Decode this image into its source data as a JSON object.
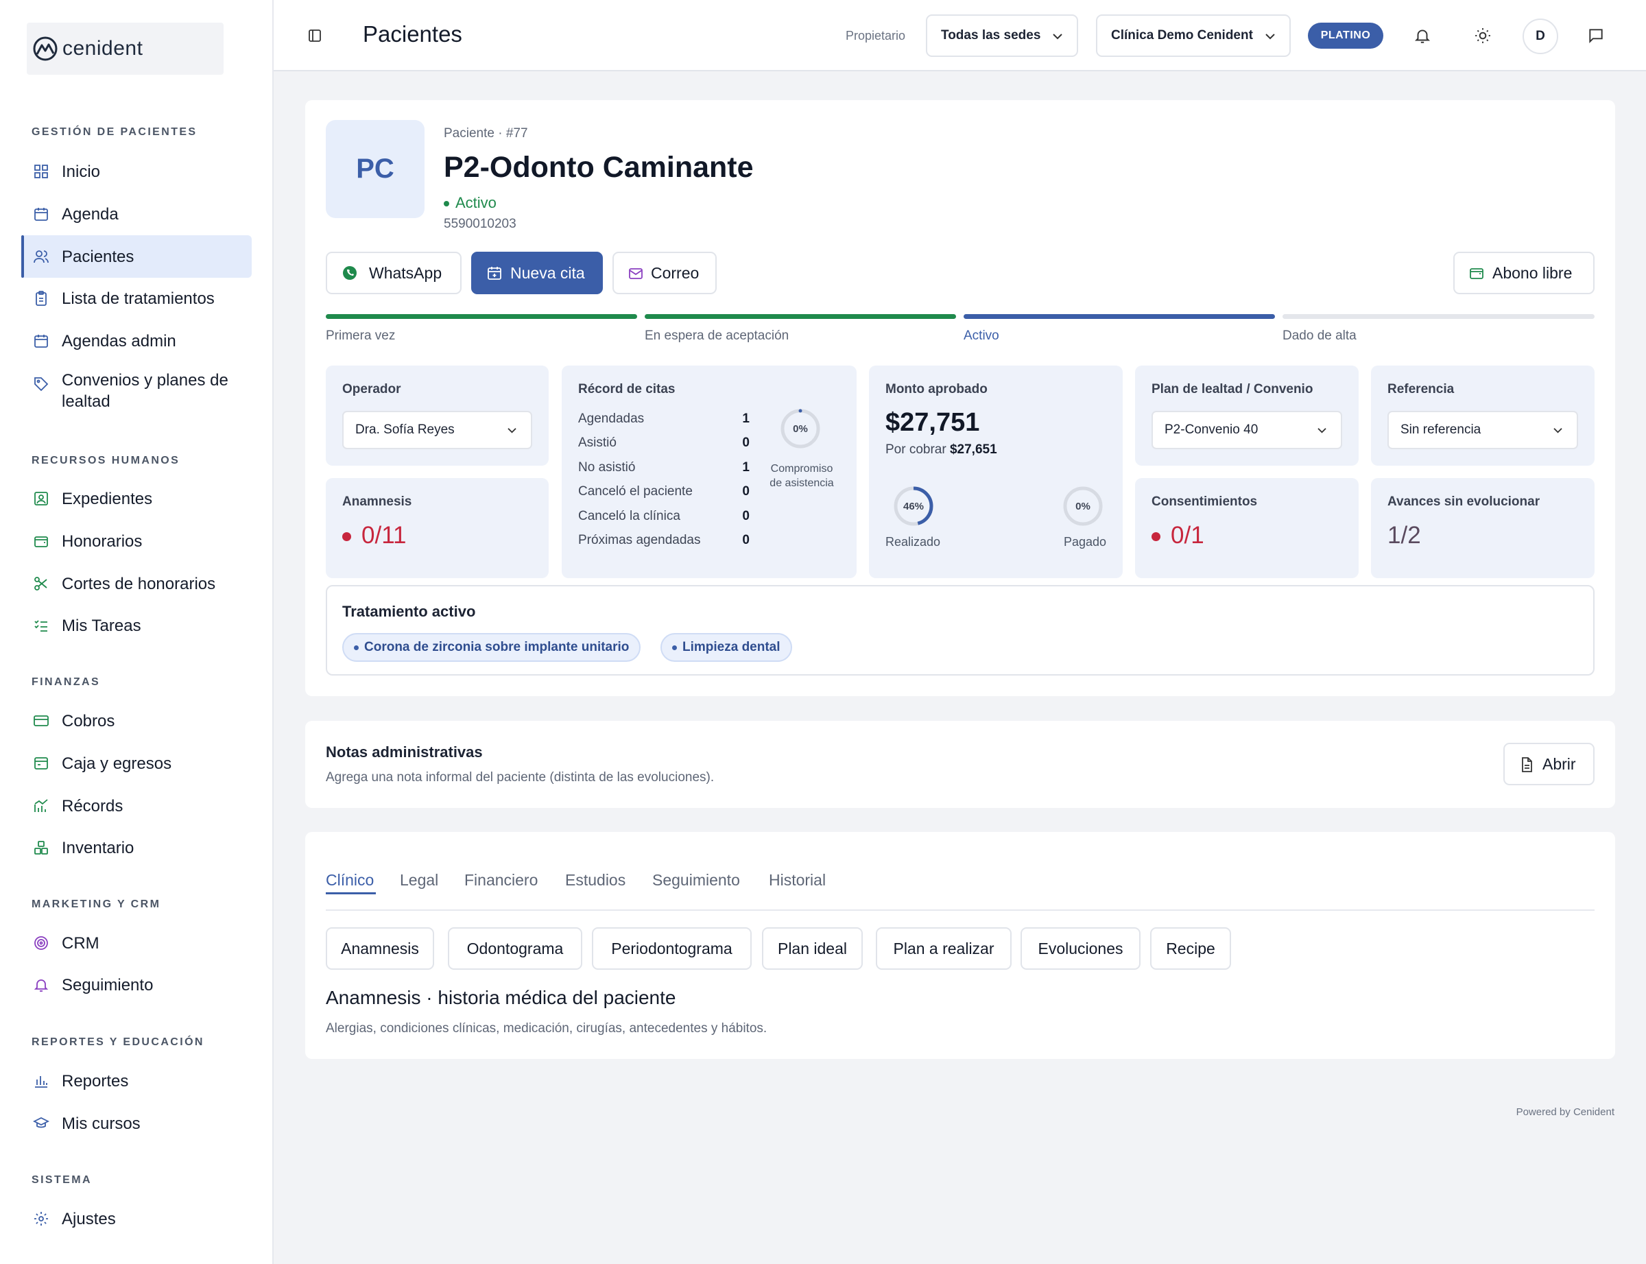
{
  "sidebar": {
    "logo_text": "cenident",
    "sections": [
      {
        "title": "GESTIÓN DE PACIENTES"
      },
      {
        "title": "RECURSOS HUMANOS"
      },
      {
        "title": "FINANZAS"
      },
      {
        "title": "MARKETING Y CRM"
      },
      {
        "title": "REPORTES Y EDUCACIÓN"
      },
      {
        "title": "SISTEMA"
      }
    ],
    "items": [
      {
        "label": "Inicio",
        "icon": "grid-icon"
      },
      {
        "label": "Agenda",
        "icon": "calendar-icon"
      },
      {
        "label": "Pacientes",
        "icon": "users-icon",
        "active": true
      },
      {
        "label": "Lista de tratamientos",
        "icon": "clipboard-icon"
      },
      {
        "label": "Agendas admin",
        "icon": "calendar-icon"
      },
      {
        "label": "Convenios y planes de lealtad",
        "icon": "tag-icon"
      },
      {
        "label": "Expedientes",
        "icon": "id-card-icon"
      },
      {
        "label": "Honorarios",
        "icon": "wallet-icon"
      },
      {
        "label": "Cortes de honorarios",
        "icon": "scissors-icon"
      },
      {
        "label": "Mis Tareas",
        "icon": "checklist-icon"
      },
      {
        "label": "Cobros",
        "icon": "credit-card-icon"
      },
      {
        "label": "Caja y egresos",
        "icon": "cash-register-icon"
      },
      {
        "label": "Récords",
        "icon": "chart-icon"
      },
      {
        "label": "Inventario",
        "icon": "boxes-icon"
      },
      {
        "label": "CRM",
        "icon": "target-icon"
      },
      {
        "label": "Seguimiento",
        "icon": "bell-icon"
      },
      {
        "label": "Reportes",
        "icon": "bar-chart-icon"
      },
      {
        "label": "Mis cursos",
        "icon": "graduation-icon"
      },
      {
        "label": "Ajustes",
        "icon": "gear-icon"
      }
    ]
  },
  "topbar": {
    "title": "Pacientes",
    "owner_label": "Propietario",
    "site_select": "Todas las sedes",
    "clinic_select": "Clínica Demo Cenident",
    "plan_badge": "PLATINO",
    "avatar_initial": "D"
  },
  "patient": {
    "initials": "PC",
    "meta": "Paciente · #77",
    "name": "P2-Odonto Caminante",
    "status": "Activo",
    "phone": "5590010203",
    "actions": {
      "whatsapp": "WhatsApp",
      "new_appointment": "Nueva cita",
      "email": "Correo",
      "free_payment": "Abono libre"
    },
    "stages": [
      {
        "label": "Primera vez",
        "state": "done",
        "color": "#1f8a4c"
      },
      {
        "label": "En espera de aceptación",
        "state": "done",
        "color": "#1f8a4c"
      },
      {
        "label": "Activo",
        "state": "current",
        "color": "#3b5ea8"
      },
      {
        "label": "Dado de alta",
        "state": "pending",
        "color": "#e4e6eb"
      }
    ],
    "operator": {
      "title": "Operador",
      "value": "Dra. Sofía Reyes"
    },
    "appointments": {
      "title": "Récord de citas",
      "rows": [
        {
          "label": "Agendadas",
          "value": "1"
        },
        {
          "label": "Asistió",
          "value": "0"
        },
        {
          "label": "No asistió",
          "value": "1"
        },
        {
          "label": "Canceló el paciente",
          "value": "0"
        },
        {
          "label": "Canceló la clínica",
          "value": "0"
        },
        {
          "label": "Próximas agendadas",
          "value": "0"
        }
      ],
      "commitment_pct": "0%",
      "commitment_value": 0,
      "commitment_label_1": "Compromiso",
      "commitment_label_2": "de asistencia"
    },
    "amount": {
      "title": "Monto aprobado",
      "value": "$27,751",
      "pending_label": "Por cobrar",
      "pending_value": "$27,651",
      "done_pct": "46%",
      "done_value": 0.46,
      "done_label": "Realizado",
      "paid_pct": "0%",
      "paid_value": 0,
      "paid_label": "Pagado"
    },
    "loyalty": {
      "title": "Plan de lealtad / Convenio",
      "value": "P2-Convenio 40"
    },
    "reference": {
      "title": "Referencia",
      "value": "Sin referencia"
    },
    "anamnesis": {
      "title": "Anamnesis",
      "value": "0/11"
    },
    "consents": {
      "title": "Consentimientos",
      "value": "0/1"
    },
    "advances": {
      "title": "Avances sin evolucionar",
      "value": "1/2"
    },
    "treatment": {
      "title": "Tratamiento activo",
      "items": [
        "Corona de zirconia sobre implante unitario",
        "Limpieza dental"
      ]
    }
  },
  "notes": {
    "title": "Notas administrativas",
    "description": "Agrega una nota informal del paciente (distinta de las evoluciones).",
    "open_button": "Abrir"
  },
  "tabs": {
    "items": [
      "Clínico",
      "Legal",
      "Financiero",
      "Estudios",
      "Seguimiento",
      "Historial"
    ],
    "active": 0,
    "sub_buttons": [
      "Anamnesis",
      "Odontograma",
      "Periodontograma",
      "Plan ideal",
      "Plan a realizar",
      "Evoluciones",
      "Recipe"
    ],
    "section_title": "Anamnesis · historia médica del paciente",
    "section_desc": "Alergias, condiciones clínicas, medicación, cirugías, antecedentes y hábitos."
  },
  "footer": "Powered by Cenident",
  "colors": {
    "accent": "#3b5ea8",
    "success": "#1f8a4c",
    "danger": "#c7263d"
  }
}
